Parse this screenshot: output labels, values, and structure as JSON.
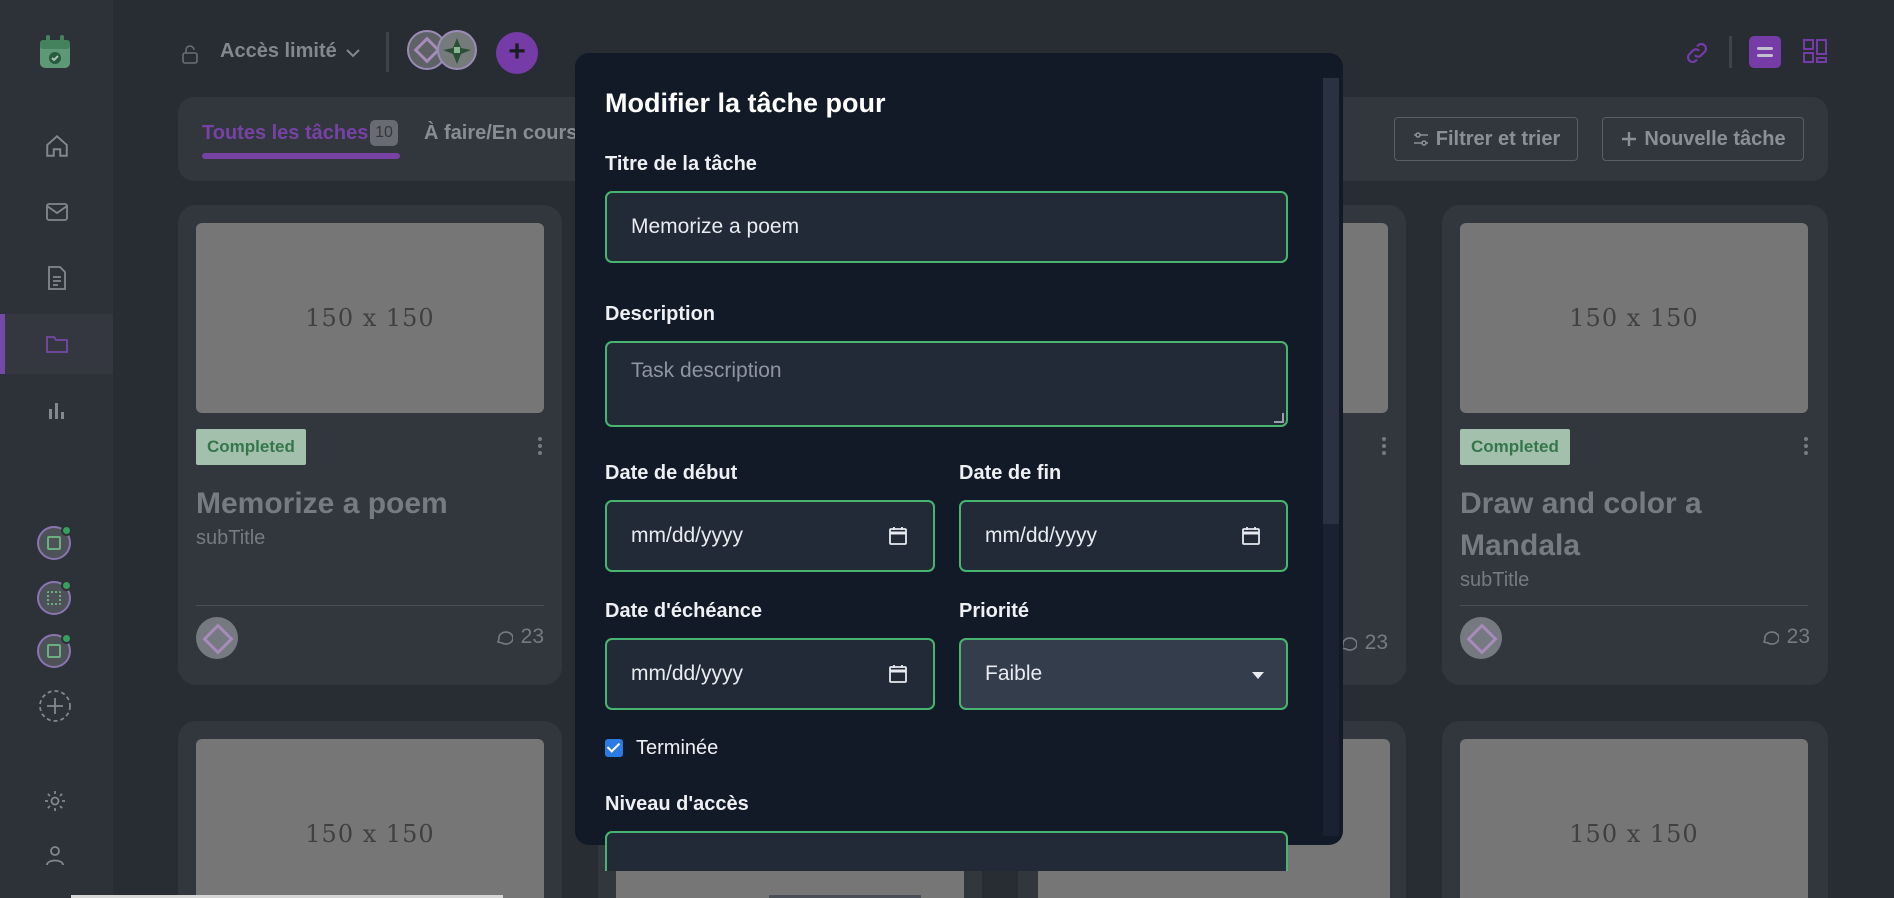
{
  "topbar": {
    "access_label": "Accès limité"
  },
  "tabs": {
    "all_label": "Toutes les tâches",
    "all_count": "10",
    "todo_label": "À faire/En cours",
    "filter_label": "Filtrer et trier",
    "new_task_label": "Nouvelle tâche"
  },
  "cards": [
    {
      "image_text": "150 x 150",
      "badge": "Completed",
      "title": "Memorize a poem",
      "subtitle": "subTitle",
      "comments": "23"
    },
    {
      "image_text": "150 x 150",
      "badge": "Completed",
      "title": "Draw and color a Mandala",
      "subtitle": "subTitle",
      "comments": "23"
    },
    {
      "comments": "23"
    },
    {
      "image_text": "150 x 150"
    },
    {
      "image_text": "150 x 150"
    }
  ],
  "modal": {
    "title": "Modifier la tâche pour",
    "title_label": "Titre de la tâche",
    "title_value": "Memorize a poem",
    "description_label": "Description",
    "description_placeholder": "Task description",
    "start_label": "Date de début",
    "start_value": "mm/dd/yyyy",
    "end_label": "Date de fin",
    "end_value": "mm/dd/yyyy",
    "due_label": "Date d'échéance",
    "due_value": "mm/dd/yyyy",
    "priority_label": "Priorité",
    "priority_value": "Faible",
    "done_label": "Terminée",
    "done_checked": true,
    "access_label": "Niveau d'accès"
  },
  "colors": {
    "accent": "#8a45c6",
    "success": "#47b56f",
    "modal_bg": "#121a28"
  }
}
